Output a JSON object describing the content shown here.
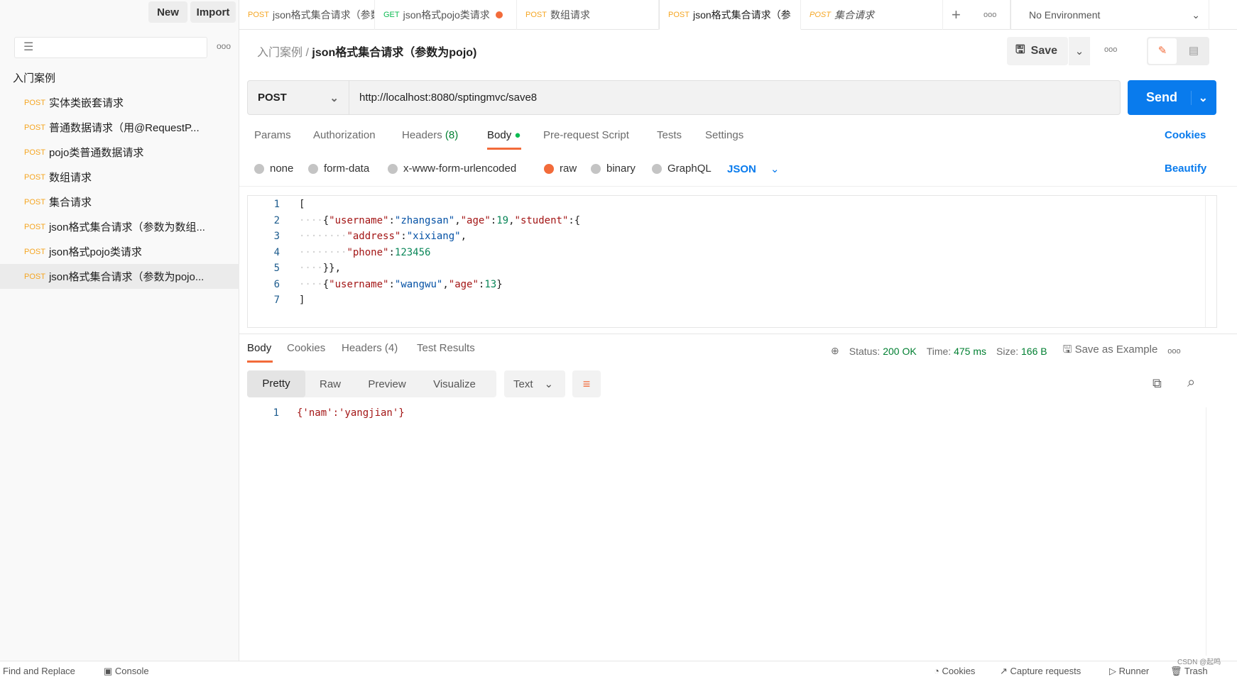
{
  "sidebar": {
    "new_label": "New",
    "import_label": "Import",
    "folder": "入门案例",
    "items": [
      {
        "method": "POST",
        "label": "实体类嵌套请求"
      },
      {
        "method": "POST",
        "label": "普通数据请求（用@RequestP..."
      },
      {
        "method": "POST",
        "label": "pojo类普通数据请求"
      },
      {
        "method": "POST",
        "label": "数组请求"
      },
      {
        "method": "POST",
        "label": "集合请求"
      },
      {
        "method": "POST",
        "label": "json格式集合请求（参数为数组..."
      },
      {
        "method": "POST",
        "label": "json格式pojo类请求"
      },
      {
        "method": "POST",
        "label": "json格式集合请求（参数为pojo..."
      }
    ]
  },
  "tabs": [
    {
      "method": "POST",
      "label": "json格式集合请求（参数"
    },
    {
      "method": "GET",
      "label": "json格式pojo类请求"
    },
    {
      "method": "POST",
      "label": "数组请求"
    },
    {
      "method": "POST",
      "label": "json格式集合请求（参"
    },
    {
      "method": "POST",
      "label": "集合请求"
    }
  ],
  "environment": "No Environment",
  "breadcrumb": {
    "folder": "入门案例",
    "sep": "/",
    "title": "json格式集合请求（参数为pojo)"
  },
  "save_label": "Save",
  "request": {
    "method": "POST",
    "url": "http://localhost:8080/sptingmvc/save8",
    "send_label": "Send"
  },
  "request_tabs": [
    "Params",
    "Authorization",
    "Headers",
    "(8)",
    "Body",
    "Pre-request Script",
    "Tests",
    "Settings"
  ],
  "cookies_label": "Cookies",
  "beautify_label": "Beautify",
  "body_modes": [
    "none",
    "form-data",
    "x-www-form-urlencoded",
    "raw",
    "binary",
    "GraphQL"
  ],
  "body_format": "JSON",
  "code_lines": [
    "1",
    "2",
    "3",
    "4",
    "5",
    "6",
    "7"
  ],
  "response": {
    "tabs": [
      "Body",
      "Cookies",
      "Headers (4)",
      "Test Results"
    ],
    "status_label": "Status:",
    "status": "200 OK",
    "time_label": "Time:",
    "time": "475 ms",
    "size_label": "Size:",
    "size": "166 B",
    "save_example": "Save as Example",
    "views": [
      "Pretty",
      "Raw",
      "Preview",
      "Visualize"
    ],
    "format": "Text",
    "line": "1",
    "body": "{'nam':'yangjian'}"
  },
  "statusbar": {
    "find": "Find and Replace",
    "console": "Console",
    "cookies": "Cookies",
    "capture": "Capture requests",
    "runner": "Runner",
    "trash": "Trash",
    "watermark": "CSDN @起鸣"
  },
  "colors": {
    "accent": "#f26b3a",
    "send": "#097bed",
    "status_green": "#007f31"
  }
}
